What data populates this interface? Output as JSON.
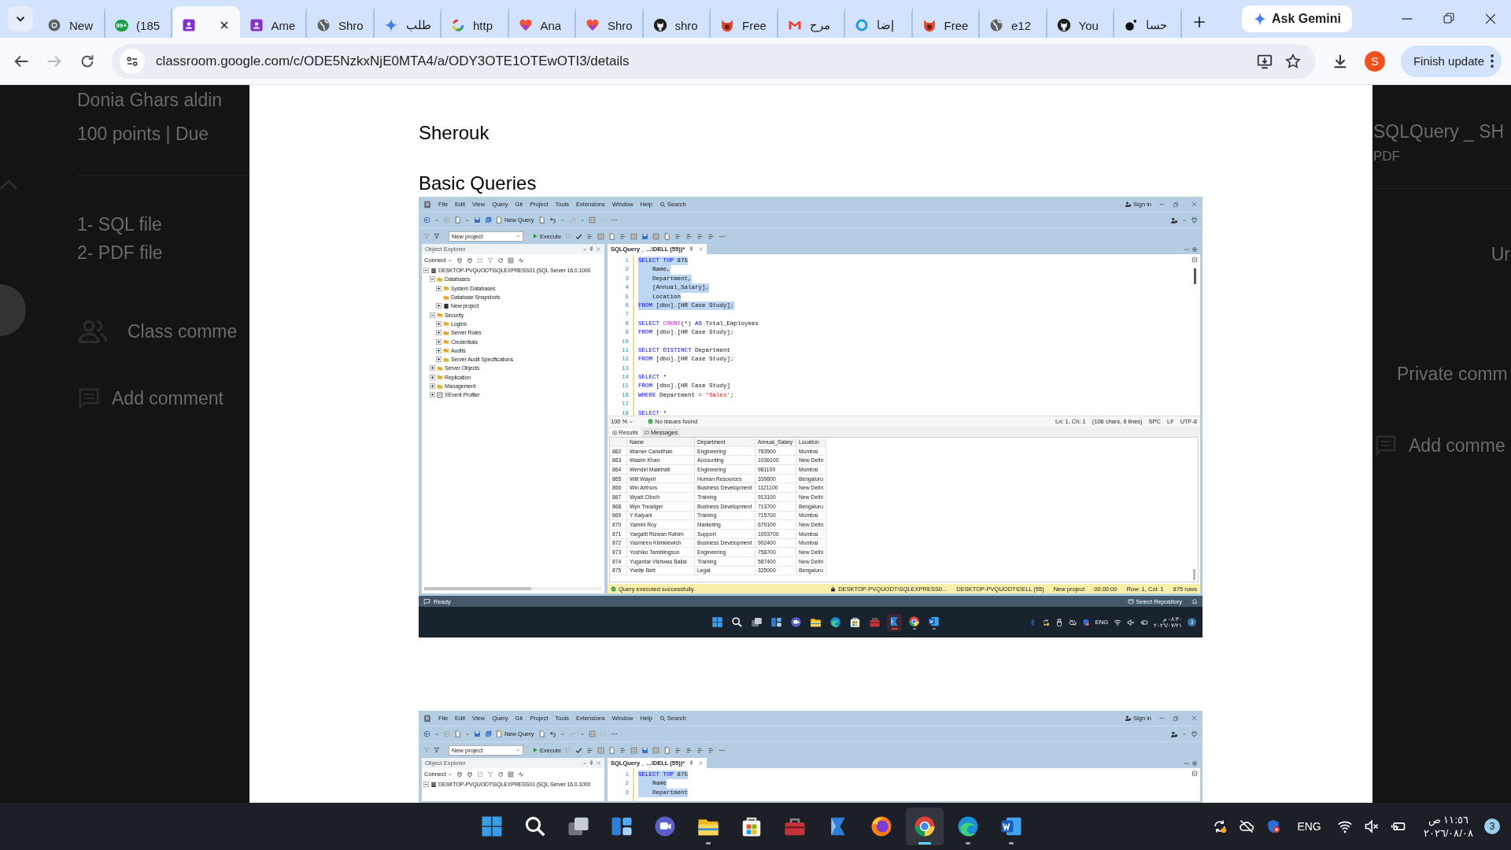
{
  "browser": {
    "tabs": [
      {
        "label": "New",
        "kind": "chrome",
        "selected": false
      },
      {
        "label": "(185",
        "kind": "badge",
        "badge": "99+",
        "selected": false
      },
      {
        "kind": "classroom",
        "selected": true
      },
      {
        "label": "Ame",
        "kind": "classroom",
        "selected": false
      },
      {
        "label": "Shro",
        "kind": "globe",
        "selected": false
      },
      {
        "label": "طلب",
        "kind": "gemini",
        "selected": false
      },
      {
        "label": "http",
        "kind": "google",
        "selected": false
      },
      {
        "label": "Ana",
        "kind": "heart",
        "selected": false
      },
      {
        "label": "Shro",
        "kind": "heart",
        "selected": false
      },
      {
        "label": "shro",
        "kind": "github",
        "selected": false
      },
      {
        "label": "Free",
        "kind": "fox",
        "selected": false
      },
      {
        "label": "مرح",
        "kind": "gmail",
        "selected": false
      },
      {
        "label": "إضا",
        "kind": "ring",
        "selected": false
      },
      {
        "label": "Free",
        "kind": "fox",
        "selected": false
      },
      {
        "label": "e12",
        "kind": "globe",
        "selected": false
      },
      {
        "label": "You",
        "kind": "github",
        "selected": false
      },
      {
        "label": "حسا",
        "kind": "dot",
        "selected": false
      }
    ],
    "ask_gemini": "Ask Gemini",
    "forward_disabled": true,
    "url": "classroom.google.com/c/ODE5NzkxNjE0MTA4/a/ODY3OTE1OTEwOTI3/details",
    "profile_initial": "S",
    "finish_update": "Finish update"
  },
  "classroom": {
    "left": {
      "author": "Donia Ghars aldin",
      "meta": "100 points  |  Due",
      "instructions": [
        "1- SQL file",
        "2- PDF file"
      ],
      "class_comments": "Class comme",
      "add_comment": "Add comment"
    },
    "right": {
      "attachment_title": "SQLQuery _ SH",
      "attachment_type": "PDF",
      "status": "Ur",
      "private_comments": "Private comm",
      "add_comment": "Add comme"
    }
  },
  "pdf": {
    "name": "Sherouk",
    "heading": "Basic Queries",
    "screenshots": [
      {
        "menu": [
          "File",
          "Edit",
          "View",
          "Query",
          "Git",
          "Project",
          "Tools",
          "Extensions",
          "Window",
          "Help"
        ],
        "search": "Search",
        "sign_in": "Sign in",
        "new_query": "New Query",
        "project": "New project",
        "execute": "Execute",
        "explorer": {
          "title": "Object Explorer",
          "connect": "Connect",
          "tree": [
            {
              "label": "DESKTOP-PVQUODT\\SQLEXPRESS01 (SQL Server 16.0.1000",
              "kind": "server",
              "expanded": true,
              "children": [
                {
                  "label": "Databases",
                  "kind": "folder",
                  "expanded": true,
                  "children": [
                    {
                      "label": "System Databases",
                      "kind": "folder",
                      "expanded": false
                    },
                    {
                      "label": "Database Snapshots",
                      "kind": "folder"
                    },
                    {
                      "label": "New project",
                      "kind": "database",
                      "expanded": false
                    }
                  ]
                },
                {
                  "label": "Security",
                  "kind": "folder",
                  "expanded": true,
                  "children": [
                    {
                      "label": "Logins",
                      "kind": "folder",
                      "expanded": false
                    },
                    {
                      "label": "Server Roles",
                      "kind": "folder",
                      "expanded": false
                    },
                    {
                      "label": "Credentials",
                      "kind": "folder",
                      "expanded": false
                    },
                    {
                      "label": "Audits",
                      "kind": "folder",
                      "expanded": false
                    },
                    {
                      "label": "Server Audit Specifications",
                      "kind": "folder",
                      "expanded": false
                    }
                  ]
                },
                {
                  "label": "Server Objects",
                  "kind": "folder",
                  "expanded": false
                },
                {
                  "label": "Replication",
                  "kind": "folder",
                  "expanded": false
                },
                {
                  "label": "Management",
                  "kind": "folder",
                  "expanded": false
                },
                {
                  "label": "XEvent Profiler",
                  "kind": "profiler",
                  "expanded": false
                }
              ]
            }
          ]
        },
        "editor": {
          "tab": "SQLQuery _ ...\\DELL (55))*",
          "lines": [
            {
              "n": "1",
              "selected": true,
              "tokens": [
                {
                  "t": "SELECT TOP",
                  "kind": "keyword"
                },
                {
                  "t": " 875",
                  "kind": "plain"
                }
              ]
            },
            {
              "n": "2",
              "selected": true,
              "tokens": [
                {
                  "t": "    Name,",
                  "kind": "plain"
                }
              ]
            },
            {
              "n": "3",
              "selected": true,
              "tokens": [
                {
                  "t": "    Department,",
                  "kind": "plain"
                }
              ]
            },
            {
              "n": "4",
              "selected": true,
              "tokens": [
                {
                  "t": "    [Annual_Salary],",
                  "kind": "plain"
                }
              ]
            },
            {
              "n": "5",
              "selected": true,
              "tokens": [
                {
                  "t": "    Location",
                  "kind": "plain"
                }
              ]
            },
            {
              "n": "6",
              "selected": true,
              "tokens": [
                {
                  "t": "FROM",
                  "kind": "keyword"
                },
                {
                  "t": " [dbo].[HR Case Study];",
                  "kind": "plain"
                }
              ]
            },
            {
              "n": "7",
              "selected": false
            },
            {
              "n": "8",
              "selected": false,
              "tokens": [
                {
                  "t": "SELECT ",
                  "kind": "keyword"
                },
                {
                  "t": "COUNT",
                  "kind": "function"
                },
                {
                  "t": "(*) ",
                  "kind": "plain"
                },
                {
                  "t": "AS",
                  "kind": "keyword"
                },
                {
                  "t": " Total_Employees",
                  "kind": "plain"
                }
              ]
            },
            {
              "n": "9",
              "selected": false,
              "tokens": [
                {
                  "t": "FROM",
                  "kind": "keyword"
                },
                {
                  "t": " [dbo].[HR Case Study];",
                  "kind": "plain"
                }
              ]
            },
            {
              "n": "10",
              "selected": false
            },
            {
              "n": "11",
              "selected": false,
              "tokens": [
                {
                  "t": "SELECT DISTINCT",
                  "kind": "keyword"
                },
                {
                  "t": " Department",
                  "kind": "plain"
                }
              ]
            },
            {
              "n": "12",
              "selected": false,
              "tokens": [
                {
                  "t": "FROM",
                  "kind": "keyword"
                },
                {
                  "t": " [dbo].[HR Case Study];",
                  "kind": "plain"
                }
              ]
            },
            {
              "n": "13",
              "selected": false
            },
            {
              "n": "14",
              "selected": false,
              "tokens": [
                {
                  "t": "SELECT",
                  "kind": "keyword"
                },
                {
                  "t": " *",
                  "kind": "plain"
                }
              ]
            },
            {
              "n": "15",
              "selected": false,
              "tokens": [
                {
                  "t": "FROM",
                  "kind": "keyword"
                },
                {
                  "t": " [dbo].[HR Case Study]",
                  "kind": "plain"
                }
              ]
            },
            {
              "n": "16",
              "selected": false,
              "tokens": [
                {
                  "t": "WHERE",
                  "kind": "keyword"
                },
                {
                  "t": " Department = ",
                  "kind": "plain"
                },
                {
                  "t": "'Sales'",
                  "kind": "string"
                },
                {
                  "t": ";",
                  "kind": "plain"
                }
              ]
            },
            {
              "n": "17",
              "selected": false
            },
            {
              "n": "18",
              "selected": false,
              "tokens": [
                {
                  "t": "SELECT",
                  "kind": "keyword"
                },
                {
                  "t": " *",
                  "kind": "plain"
                }
              ]
            }
          ]
        },
        "editor_status": {
          "zoom": "100 %",
          "issues": "No issues found",
          "fields": [
            "Ln: 1, Ch: 1",
            "(106 chars, 6 lines)",
            "SPC",
            "LF",
            "UTF-8"
          ]
        },
        "results": {
          "tabs": [
            {
              "label": "Results",
              "selected": true
            },
            {
              "label": "Messages",
              "selected": false
            }
          ],
          "columns": [
            "",
            "Name",
            "Department",
            "Annual_Salary",
            "Location"
          ],
          "rows": [
            [
              "862",
              "Warner Carwithan",
              "Engineering",
              "783900",
              "Mumbai"
            ],
            [
              "863",
              "Wasim Khan",
              "Accounting",
              "1036100",
              "New Delhi"
            ],
            [
              "864",
              "Wendel Maletratt",
              "Engineering",
              "981100",
              "Mumbai"
            ],
            [
              "865",
              "Wilt Wayvil",
              "Human Resources",
              "339600",
              "Bengaluru"
            ],
            [
              "866",
              "Win Arthurs",
              "Business Development",
              "1121100",
              "New Delhi"
            ],
            [
              "867",
              "Wyatt Clinch",
              "Training",
              "913100",
              "New Delhi"
            ],
            [
              "868",
              "Wyn Treadger",
              "Business Development",
              "713700",
              "Bengaluru"
            ],
            [
              "869",
              "Y Kalyani",
              "Training",
              "715700",
              "Mumbai"
            ],
            [
              "870",
              "Yamini Roy",
              "Marketing",
              "679100",
              "New Delhi"
            ],
            [
              "871",
              "Yargatti Rizwan Rahim",
              "Support",
              "1003700",
              "Mumbai"
            ],
            [
              "872",
              "Yasmeen Klimkiewich",
              "Business Development",
              "902400",
              "Mumbai"
            ],
            [
              "873",
              "Yoshiko Tamblingson",
              "Engineering",
              "758700",
              "New Delhi"
            ],
            [
              "874",
              "Yugantar Vishwas Ballal",
              "Training",
              "587400",
              "New Delhi"
            ],
            [
              "875",
              "Yvette Bett",
              "Legal",
              "325000",
              "Bengaluru"
            ]
          ]
        },
        "query_status": {
          "message": "Query executed successfully.",
          "fields": [
            "DESKTOP-PVQUODT\\SQLEXPRESS0...",
            "DESKTOP-PVQUODT\\DELL (55)",
            "New project",
            "00:00:00",
            "Row: 1, Col: 1",
            "875 rows"
          ]
        },
        "ready": "Ready",
        "select_repository": "Select Repository",
        "taskbar": {
          "apps": [
            {
              "kind": "start",
              "open": false,
              "selected": false
            },
            {
              "kind": "search",
              "open": false,
              "selected": false
            },
            {
              "kind": "taskview",
              "open": false,
              "selected": false
            },
            {
              "kind": "widgets",
              "open": false,
              "selected": false
            },
            {
              "kind": "chat",
              "open": false,
              "selected": false
            },
            {
              "kind": "files",
              "open": false,
              "selected": false
            },
            {
              "kind": "edge",
              "open": false,
              "selected": false
            },
            {
              "kind": "store",
              "open": false,
              "selected": false
            },
            {
              "kind": "toolbox",
              "open": false,
              "selected": false
            },
            {
              "kind": "sheets",
              "open": true,
              "selected": true
            },
            {
              "kind": "chrome",
              "open": true,
              "selected": false
            },
            {
              "kind": "word",
              "open": true,
              "selected": false
            }
          ],
          "language": "ENG",
          "time": "٠٨:٣٠ م",
          "date": "٢٠٢٦/٠٧/٢١",
          "notifications": "3"
        }
      },
      {
        "menu": [
          "File",
          "Edit",
          "View",
          "Query",
          "Git",
          "Project",
          "Tools",
          "Extensions",
          "Window",
          "Help"
        ],
        "search": "Search",
        "sign_in": "Sign in",
        "new_query": "New Query",
        "project": "New project",
        "execute": "Execute",
        "explorer": {
          "title": "Object Explorer",
          "connect": "Connect",
          "tree": [
            {
              "label": "DESKTOP-PVQUODT\\SQLEXPRESS01 (SQL Server 16.0.1000",
              "kind": "server",
              "expanded": true
            }
          ]
        },
        "editor": {
          "tab": "SQLQuery _ ...\\DELL (55))*",
          "lines": [
            {
              "n": "1",
              "selected": true,
              "tokens": [
                {
                  "t": "SELECT TOP",
                  "kind": "keyword"
                },
                {
                  "t": " 875",
                  "kind": "plain"
                }
              ]
            },
            {
              "n": "2",
              "selected": true,
              "tokens": [
                {
                  "t": "    Name",
                  "kind": "plain"
                }
              ]
            },
            {
              "n": "3",
              "selected": true,
              "tokens": [
                {
                  "t": "    Department",
                  "kind": "plain"
                }
              ]
            }
          ]
        }
      }
    ]
  },
  "taskbar": {
    "apps": [
      {
        "kind": "start",
        "open": false,
        "selected": false
      },
      {
        "kind": "search",
        "open": false,
        "selected": false
      },
      {
        "kind": "taskview",
        "open": false,
        "selected": false
      },
      {
        "kind": "widgets",
        "open": false,
        "selected": false
      },
      {
        "kind": "chat",
        "open": false,
        "selected": false
      },
      {
        "kind": "files",
        "open": true,
        "selected": false
      },
      {
        "kind": "store",
        "open": false,
        "selected": false
      },
      {
        "kind": "toolbox",
        "open": false,
        "selected": false
      },
      {
        "kind": "sheets",
        "open": false,
        "selected": false
      },
      {
        "kind": "firefox",
        "open": false,
        "selected": false
      },
      {
        "kind": "chrome",
        "open": true,
        "selected": true
      },
      {
        "kind": "edge",
        "open": true,
        "selected": false
      },
      {
        "kind": "word",
        "open": true,
        "selected": false
      }
    ],
    "language": "ENG",
    "time": "١١:٥٦ ص",
    "date": "٢٠٢٦/٠٨/٠٨",
    "notifications": "3"
  }
}
